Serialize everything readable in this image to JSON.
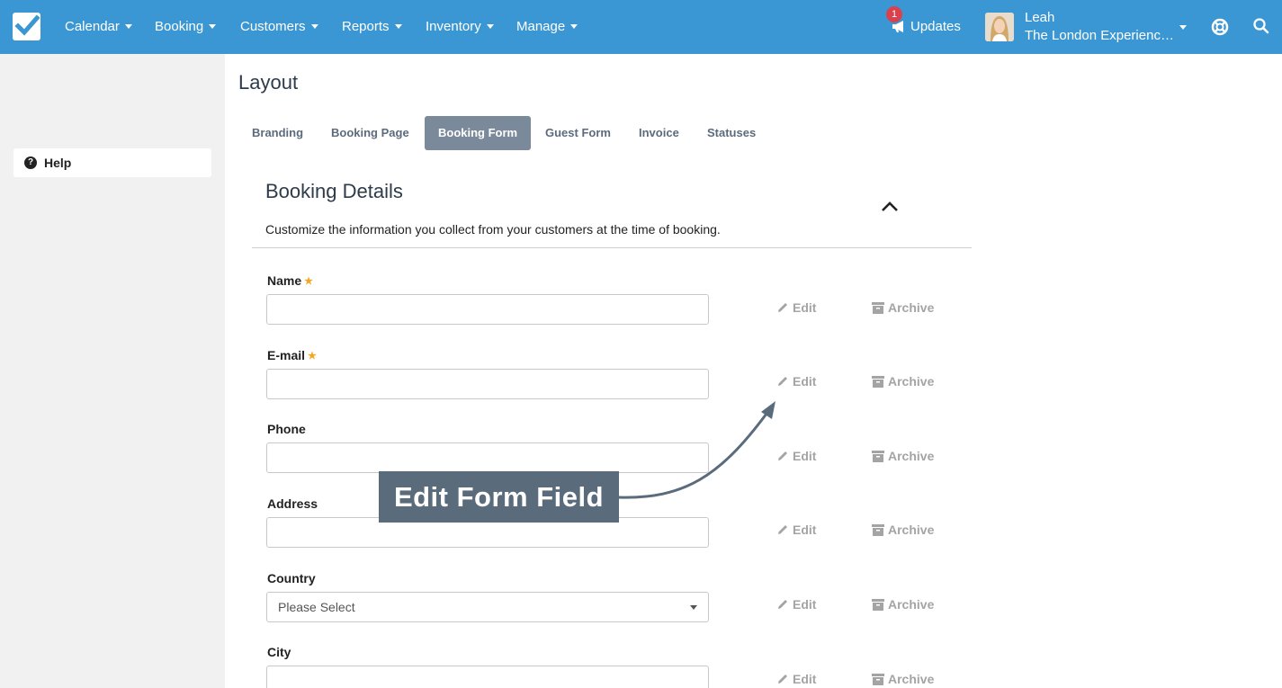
{
  "nav": {
    "items": [
      "Calendar",
      "Booking",
      "Customers",
      "Reports",
      "Inventory",
      "Manage"
    ],
    "updates_label": "Updates",
    "updates_badge": "1",
    "user_name": "Leah",
    "user_company": "The London Experienc…"
  },
  "sidebar": {
    "help_label": "Help"
  },
  "page": {
    "title": "Layout",
    "tabs": [
      "Branding",
      "Booking Page",
      "Booking Form",
      "Guest Form",
      "Invoice",
      "Statuses"
    ],
    "active_tab": "Booking Form"
  },
  "section": {
    "title": "Booking Details",
    "description": "Customize the information you collect from your customers at the time of booking."
  },
  "fields": [
    {
      "label": "Name",
      "required": "★",
      "type": "text"
    },
    {
      "label": "E-mail",
      "required": "★",
      "type": "text"
    },
    {
      "label": "Phone",
      "type": "text"
    },
    {
      "label": "Address",
      "type": "text"
    },
    {
      "label": "Country",
      "type": "select",
      "placeholder": "Please Select"
    },
    {
      "label": "City",
      "type": "text"
    }
  ],
  "actions": {
    "edit_label": "Edit",
    "archive_label": "Archive"
  },
  "callout": {
    "text": "Edit Form Field"
  },
  "colors": {
    "topbar": "#3a97d4",
    "active_tab": "#7b8a9a",
    "callout": "#5a6b7c",
    "required_star": "#f5a623",
    "badge": "#d9414c"
  }
}
